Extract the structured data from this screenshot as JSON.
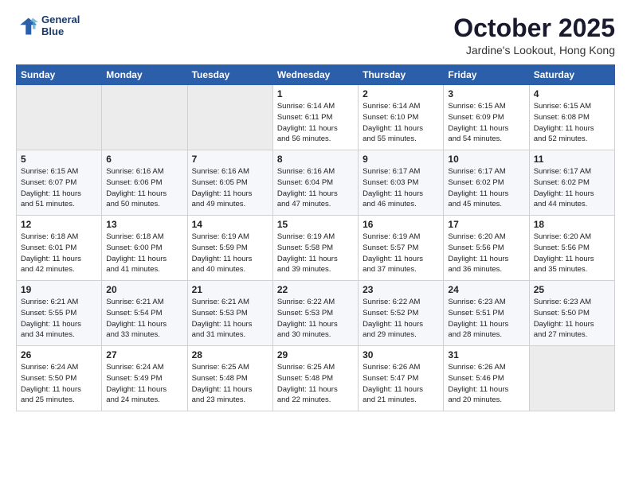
{
  "header": {
    "logo_line1": "General",
    "logo_line2": "Blue",
    "month": "October 2025",
    "location": "Jardine's Lookout, Hong Kong"
  },
  "days_of_week": [
    "Sunday",
    "Monday",
    "Tuesday",
    "Wednesday",
    "Thursday",
    "Friday",
    "Saturday"
  ],
  "weeks": [
    [
      {
        "day": "",
        "info": ""
      },
      {
        "day": "",
        "info": ""
      },
      {
        "day": "",
        "info": ""
      },
      {
        "day": "1",
        "info": "Sunrise: 6:14 AM\nSunset: 6:11 PM\nDaylight: 11 hours\nand 56 minutes."
      },
      {
        "day": "2",
        "info": "Sunrise: 6:14 AM\nSunset: 6:10 PM\nDaylight: 11 hours\nand 55 minutes."
      },
      {
        "day": "3",
        "info": "Sunrise: 6:15 AM\nSunset: 6:09 PM\nDaylight: 11 hours\nand 54 minutes."
      },
      {
        "day": "4",
        "info": "Sunrise: 6:15 AM\nSunset: 6:08 PM\nDaylight: 11 hours\nand 52 minutes."
      }
    ],
    [
      {
        "day": "5",
        "info": "Sunrise: 6:15 AM\nSunset: 6:07 PM\nDaylight: 11 hours\nand 51 minutes."
      },
      {
        "day": "6",
        "info": "Sunrise: 6:16 AM\nSunset: 6:06 PM\nDaylight: 11 hours\nand 50 minutes."
      },
      {
        "day": "7",
        "info": "Sunrise: 6:16 AM\nSunset: 6:05 PM\nDaylight: 11 hours\nand 49 minutes."
      },
      {
        "day": "8",
        "info": "Sunrise: 6:16 AM\nSunset: 6:04 PM\nDaylight: 11 hours\nand 47 minutes."
      },
      {
        "day": "9",
        "info": "Sunrise: 6:17 AM\nSunset: 6:03 PM\nDaylight: 11 hours\nand 46 minutes."
      },
      {
        "day": "10",
        "info": "Sunrise: 6:17 AM\nSunset: 6:02 PM\nDaylight: 11 hours\nand 45 minutes."
      },
      {
        "day": "11",
        "info": "Sunrise: 6:17 AM\nSunset: 6:02 PM\nDaylight: 11 hours\nand 44 minutes."
      }
    ],
    [
      {
        "day": "12",
        "info": "Sunrise: 6:18 AM\nSunset: 6:01 PM\nDaylight: 11 hours\nand 42 minutes."
      },
      {
        "day": "13",
        "info": "Sunrise: 6:18 AM\nSunset: 6:00 PM\nDaylight: 11 hours\nand 41 minutes."
      },
      {
        "day": "14",
        "info": "Sunrise: 6:19 AM\nSunset: 5:59 PM\nDaylight: 11 hours\nand 40 minutes."
      },
      {
        "day": "15",
        "info": "Sunrise: 6:19 AM\nSunset: 5:58 PM\nDaylight: 11 hours\nand 39 minutes."
      },
      {
        "day": "16",
        "info": "Sunrise: 6:19 AM\nSunset: 5:57 PM\nDaylight: 11 hours\nand 37 minutes."
      },
      {
        "day": "17",
        "info": "Sunrise: 6:20 AM\nSunset: 5:56 PM\nDaylight: 11 hours\nand 36 minutes."
      },
      {
        "day": "18",
        "info": "Sunrise: 6:20 AM\nSunset: 5:56 PM\nDaylight: 11 hours\nand 35 minutes."
      }
    ],
    [
      {
        "day": "19",
        "info": "Sunrise: 6:21 AM\nSunset: 5:55 PM\nDaylight: 11 hours\nand 34 minutes."
      },
      {
        "day": "20",
        "info": "Sunrise: 6:21 AM\nSunset: 5:54 PM\nDaylight: 11 hours\nand 33 minutes."
      },
      {
        "day": "21",
        "info": "Sunrise: 6:21 AM\nSunset: 5:53 PM\nDaylight: 11 hours\nand 31 minutes."
      },
      {
        "day": "22",
        "info": "Sunrise: 6:22 AM\nSunset: 5:53 PM\nDaylight: 11 hours\nand 30 minutes."
      },
      {
        "day": "23",
        "info": "Sunrise: 6:22 AM\nSunset: 5:52 PM\nDaylight: 11 hours\nand 29 minutes."
      },
      {
        "day": "24",
        "info": "Sunrise: 6:23 AM\nSunset: 5:51 PM\nDaylight: 11 hours\nand 28 minutes."
      },
      {
        "day": "25",
        "info": "Sunrise: 6:23 AM\nSunset: 5:50 PM\nDaylight: 11 hours\nand 27 minutes."
      }
    ],
    [
      {
        "day": "26",
        "info": "Sunrise: 6:24 AM\nSunset: 5:50 PM\nDaylight: 11 hours\nand 25 minutes."
      },
      {
        "day": "27",
        "info": "Sunrise: 6:24 AM\nSunset: 5:49 PM\nDaylight: 11 hours\nand 24 minutes."
      },
      {
        "day": "28",
        "info": "Sunrise: 6:25 AM\nSunset: 5:48 PM\nDaylight: 11 hours\nand 23 minutes."
      },
      {
        "day": "29",
        "info": "Sunrise: 6:25 AM\nSunset: 5:48 PM\nDaylight: 11 hours\nand 22 minutes."
      },
      {
        "day": "30",
        "info": "Sunrise: 6:26 AM\nSunset: 5:47 PM\nDaylight: 11 hours\nand 21 minutes."
      },
      {
        "day": "31",
        "info": "Sunrise: 6:26 AM\nSunset: 5:46 PM\nDaylight: 11 hours\nand 20 minutes."
      },
      {
        "day": "",
        "info": ""
      }
    ]
  ]
}
